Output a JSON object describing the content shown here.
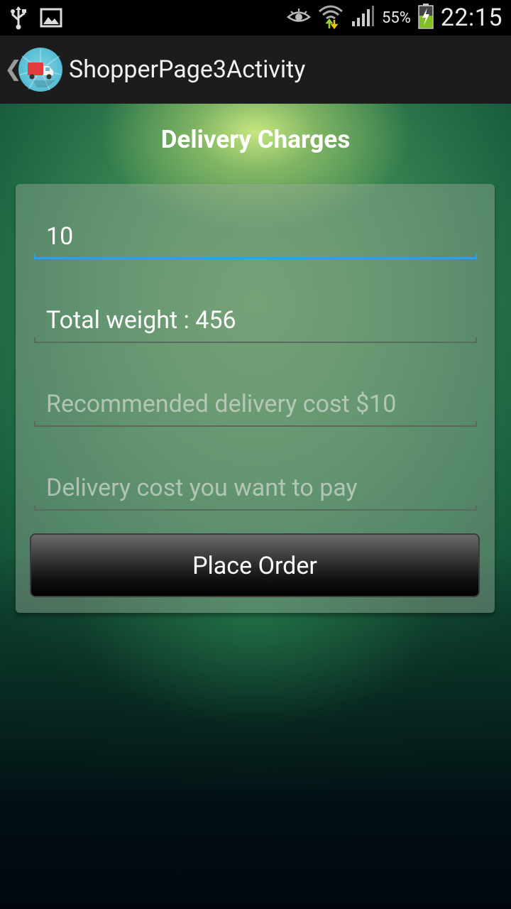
{
  "status_bar": {
    "battery_percent": "55%",
    "time": "22:15",
    "icons": [
      "usb-icon",
      "image-icon",
      "eye-icon",
      "wifi-icon",
      "signal-icon",
      "battery-charging-icon"
    ]
  },
  "action_bar": {
    "title": "ShopperPage3Activity",
    "icon": "delivery-truck-icon"
  },
  "page": {
    "heading": "Delivery Charges"
  },
  "form": {
    "quantity_value": "10",
    "total_weight_text": "Total weight : 456",
    "recommended_placeholder": "Recommended delivery cost $10",
    "pay_placeholder": "Delivery cost you want to pay",
    "place_order_label": "Place Order"
  },
  "colors": {
    "focus_accent": "#2aa6d6",
    "action_bar_bg": "#1c1c1c",
    "card_bg": "rgba(150,170,150,0.45)"
  }
}
